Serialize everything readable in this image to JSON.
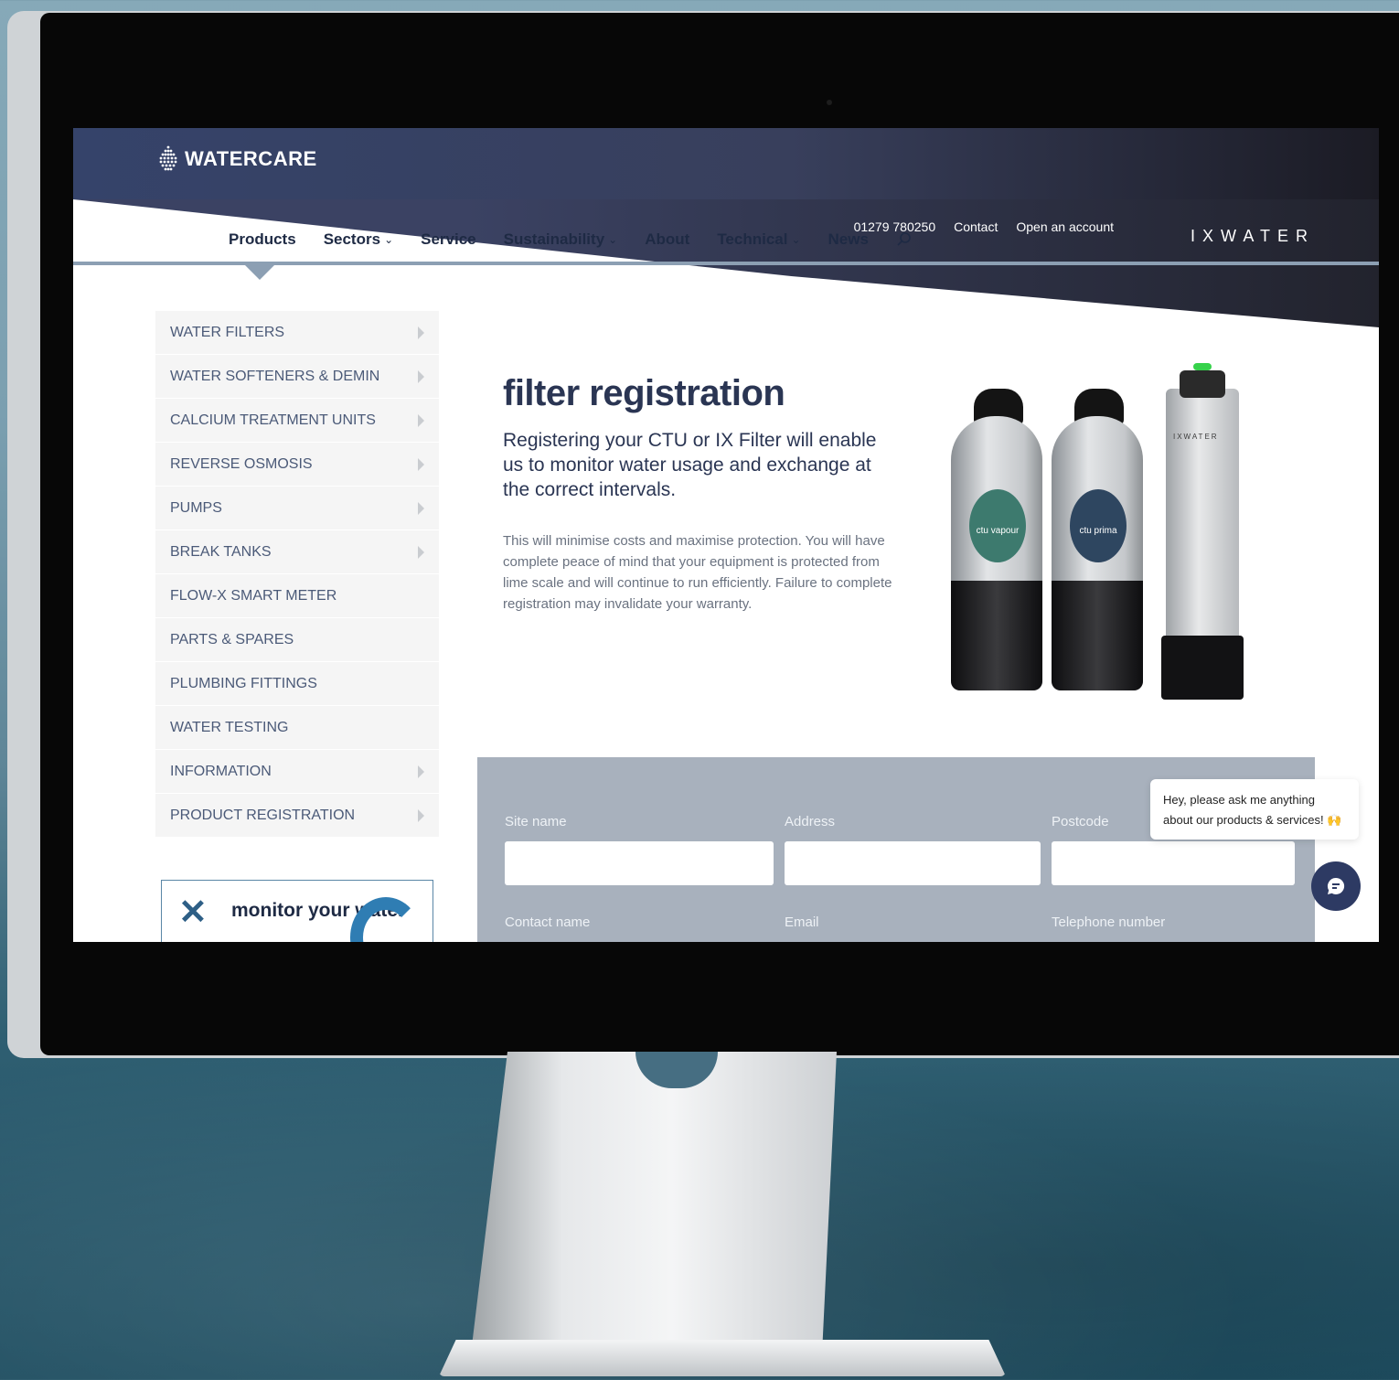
{
  "header": {
    "logo_text": "WATERCARE",
    "phone": "01279 780250",
    "contact_label": "Contact",
    "open_account_label": "Open an account",
    "partner_logo_text": "IXWATER"
  },
  "nav": {
    "items": [
      {
        "label": "Products",
        "dropdown": false
      },
      {
        "label": "Sectors",
        "dropdown": true
      },
      {
        "label": "Service",
        "dropdown": false
      },
      {
        "label": "Sustainability",
        "dropdown": true
      },
      {
        "label": "About",
        "dropdown": false
      },
      {
        "label": "Technical",
        "dropdown": true
      },
      {
        "label": "News",
        "dropdown": false
      }
    ],
    "chevron": "⌄",
    "search_icon": "search-icon"
  },
  "sidebar": {
    "items": [
      {
        "label": "WATER FILTERS",
        "arrow": true
      },
      {
        "label": "WATER SOFTENERS & DEMIN",
        "arrow": true
      },
      {
        "label": "CALCIUM TREATMENT UNITS",
        "arrow": true
      },
      {
        "label": "REVERSE OSMOSIS",
        "arrow": true
      },
      {
        "label": "PUMPS",
        "arrow": true
      },
      {
        "label": "BREAK TANKS",
        "arrow": true
      },
      {
        "label": "FLOW-X SMART METER",
        "arrow": false
      },
      {
        "label": "PARTS & SPARES",
        "arrow": false
      },
      {
        "label": "PLUMBING FITTINGS",
        "arrow": false
      },
      {
        "label": "WATER TESTING",
        "arrow": false
      },
      {
        "label": "INFORMATION",
        "arrow": true
      },
      {
        "label": "PRODUCT REGISTRATION",
        "arrow": true
      }
    ],
    "promo_text": "monitor your water"
  },
  "main": {
    "title": "filter registration",
    "subtitle": "Registering your CTU or IX Filter will enable us to monitor water usage and exchange at the correct intervals.",
    "body": "This will minimise costs and maximise protection. You will have complete peace of mind that your equipment is protected from lime scale and will continue to run efficiently. Failure to complete registration may invalidate your warranty.",
    "products": {
      "bottle1_label": "ctu vapour",
      "bottle2_label": "ctu prima",
      "unit_label": "IXWATER"
    }
  },
  "form": {
    "fields": [
      {
        "label": "Site name",
        "value": ""
      },
      {
        "label": "Address",
        "value": ""
      },
      {
        "label": "Postcode",
        "value": ""
      },
      {
        "label": "Contact name",
        "value": ""
      },
      {
        "label": "Email",
        "value": ""
      },
      {
        "label": "Telephone number",
        "value": ""
      }
    ]
  },
  "chat": {
    "message": "Hey, please ask me anything about our products & services! 🙌"
  },
  "colors": {
    "brand_navy": "#35436a",
    "nav_text": "#1e2a44",
    "sidebar_text": "#4b5a78",
    "form_bg": "#a8b1bd",
    "accent_blue": "#2f7db3"
  }
}
